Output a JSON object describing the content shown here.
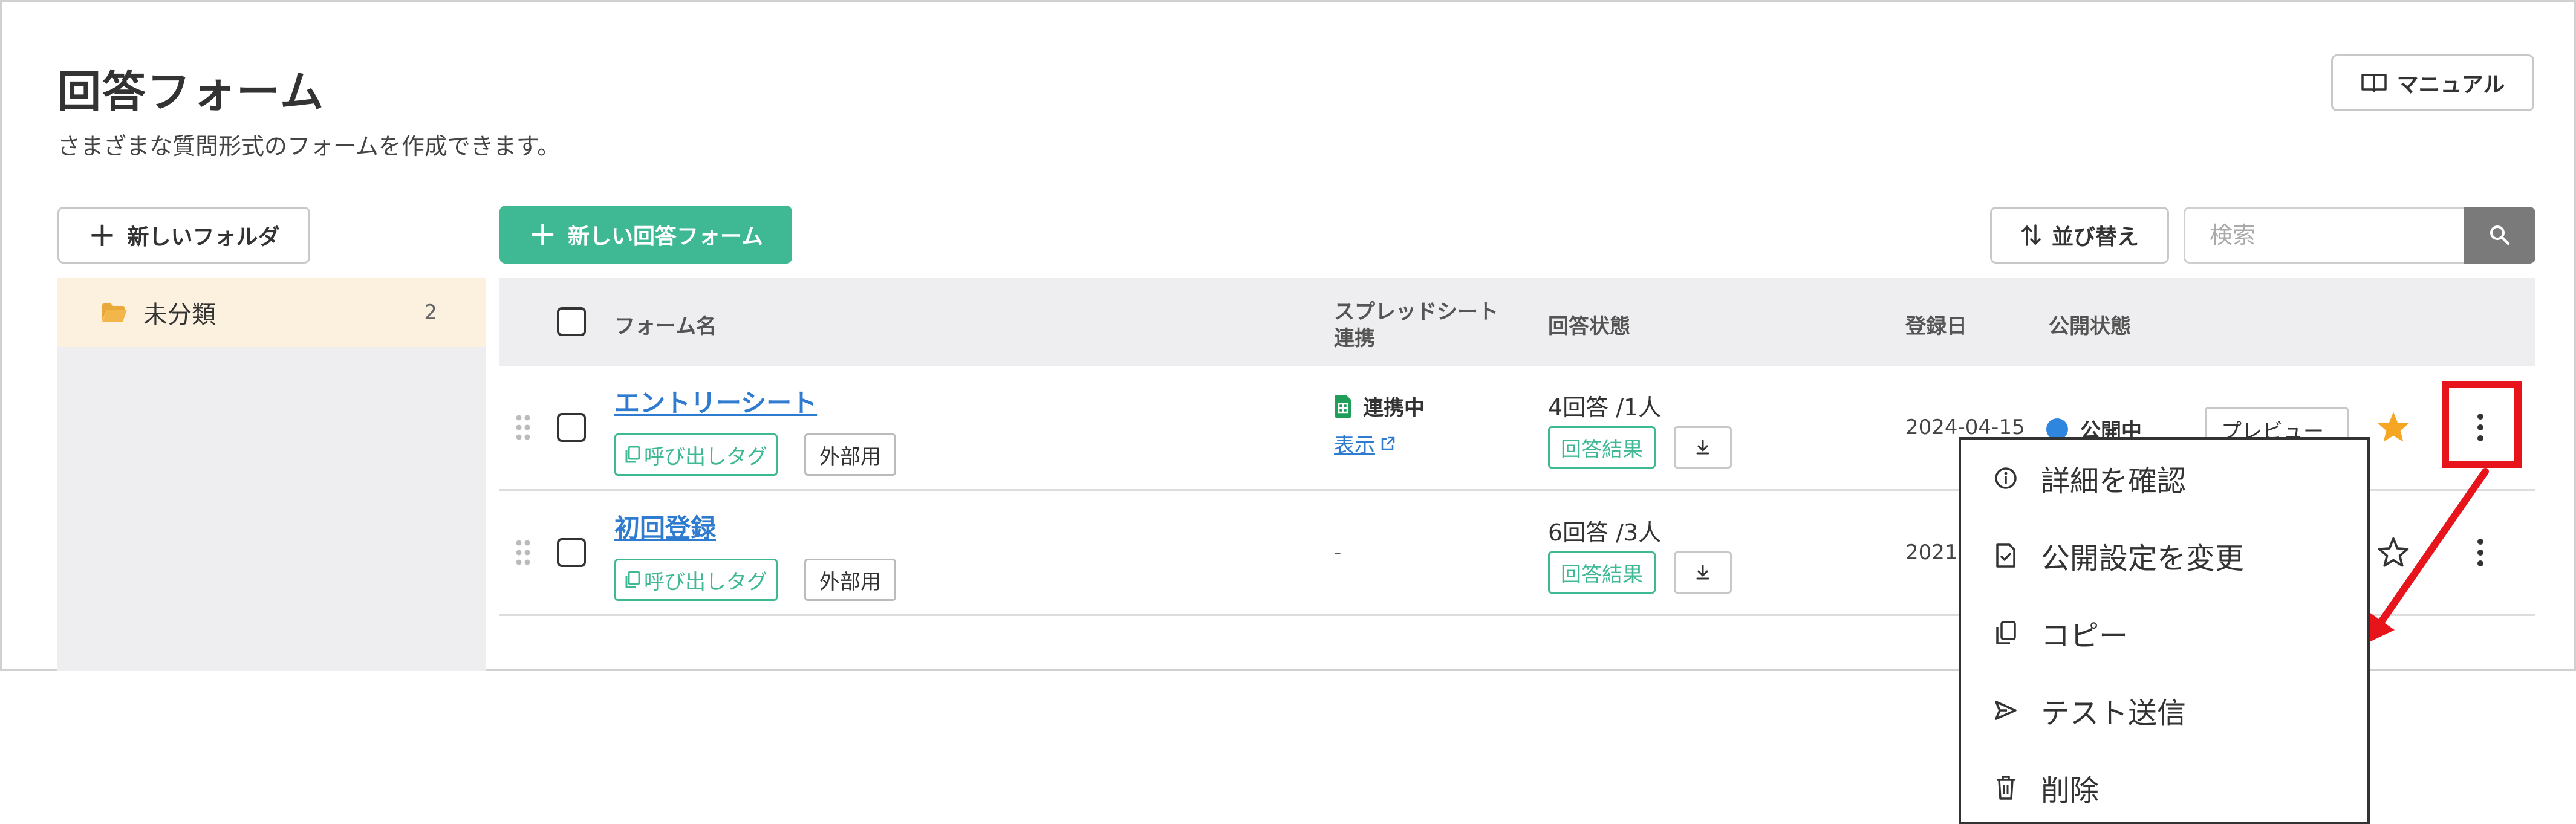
{
  "header": {
    "title": "回答フォーム",
    "subtitle": "さまざまな質問形式のフォームを作成できます。",
    "manual_label": "マニュアル"
  },
  "toolbar": {
    "new_folder_label": "新しいフォルダ",
    "new_form_label": "新しい回答フォーム",
    "sort_label": "並び替え",
    "search_placeholder": "検索"
  },
  "sidebar": {
    "folders": [
      {
        "label": "未分類",
        "count": "2"
      }
    ]
  },
  "table": {
    "columns": {
      "name": "フォーム名",
      "sheet_line1": "スプレッドシート",
      "sheet_line2": "連携",
      "answers": "回答状態",
      "date": "登録日",
      "publish": "公開状態"
    },
    "rows": [
      {
        "name": "エントリーシート",
        "tag_call": "呼び出しタグ",
        "tag_ext": "外部用",
        "sheet_status": "連携中",
        "sheet_link": "表示",
        "answers": "4回答 /1人",
        "result_label": "回答結果",
        "date": "2024-04-15",
        "publish_status": "公開中",
        "preview_label": "プレビュー",
        "starred": true
      },
      {
        "name": "初回登録",
        "tag_call": "呼び出しタグ",
        "tag_ext": "外部用",
        "sheet_status": "-",
        "answers": "6回答 /3人",
        "result_label": "回答結果",
        "date": "2021-",
        "starred": false
      }
    ]
  },
  "context_menu": {
    "items": [
      {
        "label": "詳細を確認",
        "icon": "info-icon"
      },
      {
        "label": "公開設定を変更",
        "icon": "document-check-icon"
      },
      {
        "label": "コピー",
        "icon": "copy-icon"
      },
      {
        "label": "テスト送信",
        "icon": "send-icon"
      },
      {
        "label": "削除",
        "icon": "trash-icon"
      }
    ]
  },
  "colors": {
    "accent_green": "#3fb894",
    "link_blue": "#2e7bcf",
    "star_orange": "#f5a623",
    "highlight_red": "#e8141c",
    "folder_bg": "#fcf1df"
  }
}
